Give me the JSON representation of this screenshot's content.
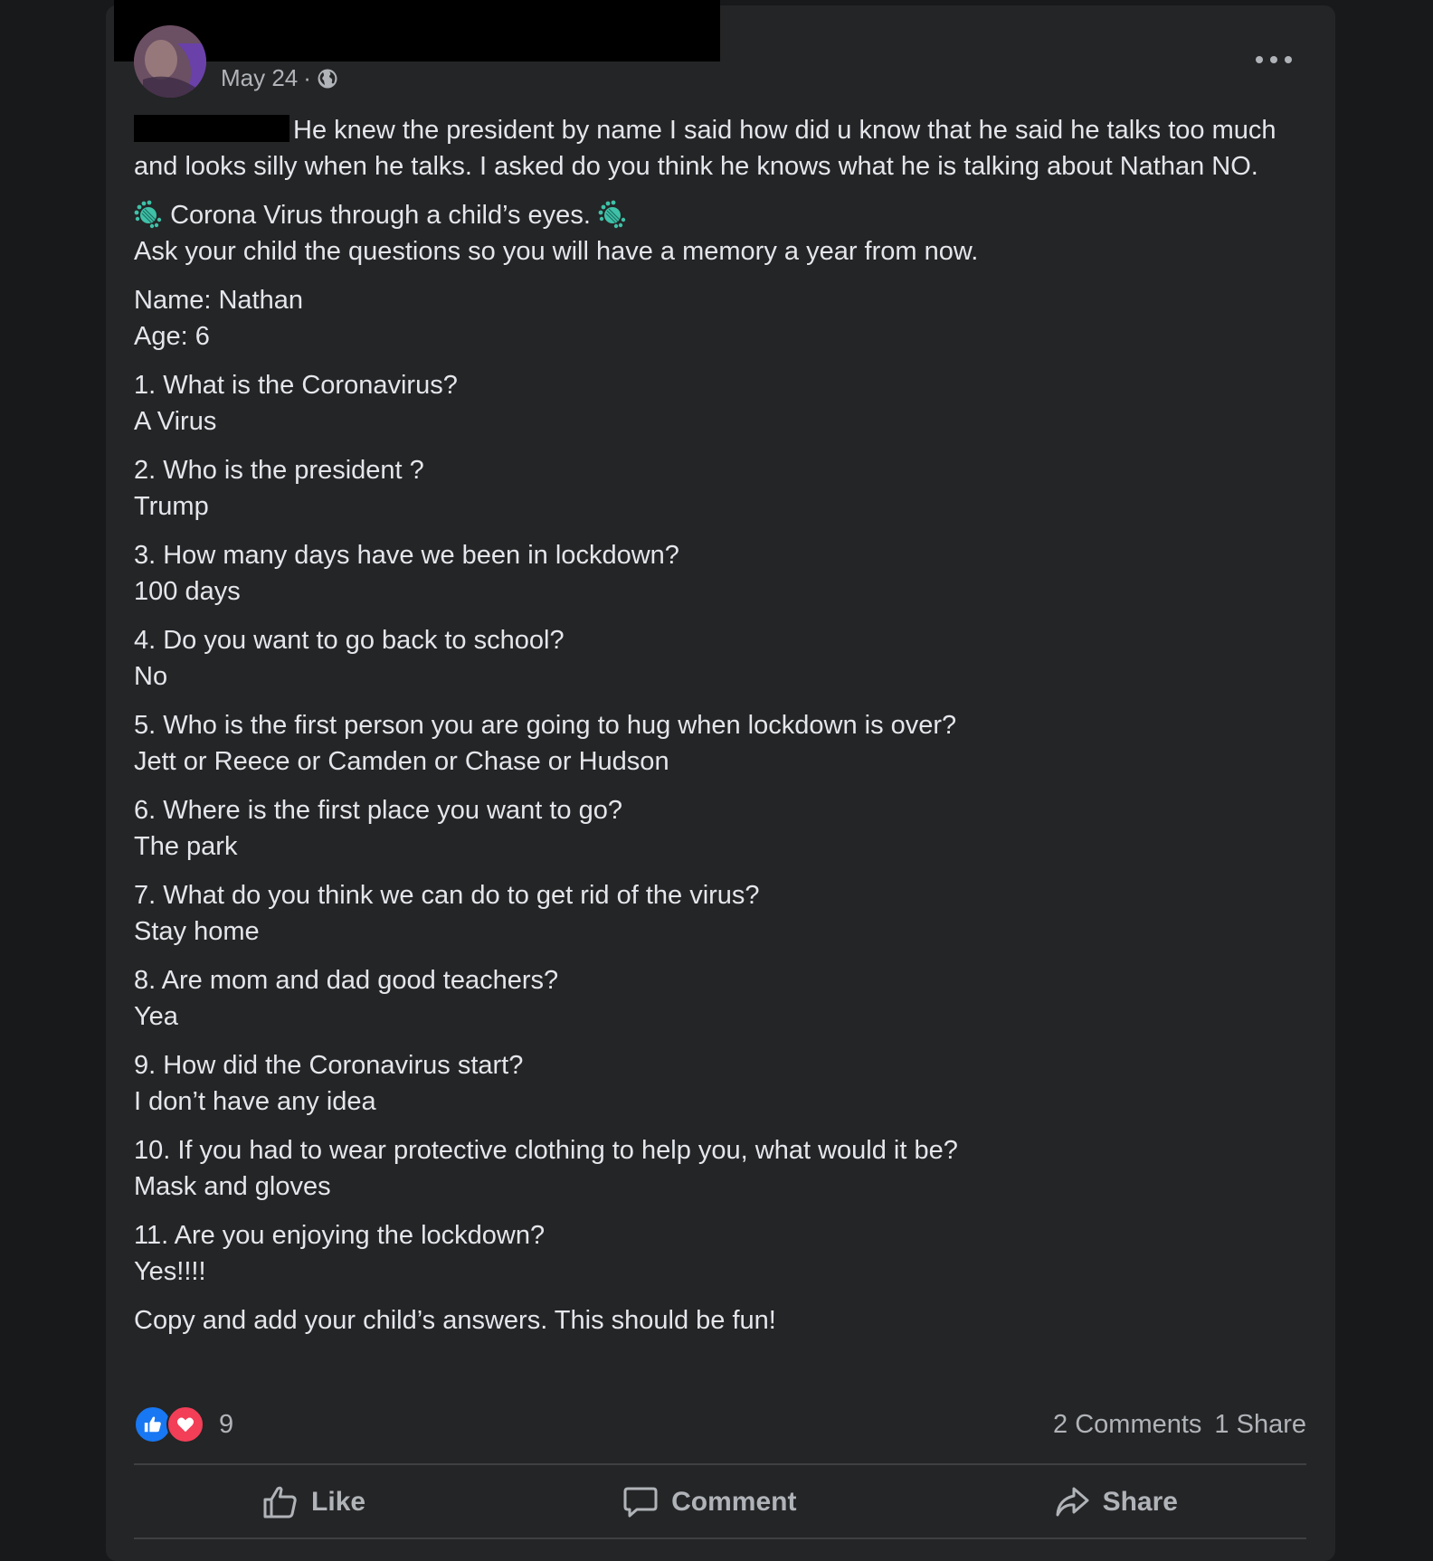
{
  "post": {
    "date": "May 24",
    "separator": "·",
    "paragraphs": {
      "intro": "He knew the president by name I said how did u know that he said he talks too much and looks silly when he talks. I asked do you think he knows what he is talking about Nathan NO.",
      "title": "Corona Virus through a child’s eyes.",
      "subtitle": "Ask your child the questions so you will have a memory a year from now.",
      "name": "Name: Nathan",
      "age": "Age: 6",
      "qa": [
        {
          "q": "1. What is the Coronavirus?",
          "a": "A Virus"
        },
        {
          "q": "2. Who is the president ?",
          "a": "Trump"
        },
        {
          "q": "3. How many days have we been in lockdown?",
          "a": "100 days"
        },
        {
          "q": "4. Do you want to go back to school?",
          "a": "No"
        },
        {
          "q": "5. Who is the first person you are going to hug when lockdown is over?",
          "a": "Jett or Reece or Camden or Chase or Hudson"
        },
        {
          "q": "6. Where is the first place you want to go?",
          "a": "The park"
        },
        {
          "q": "7. What do you think we can do to get rid of the virus?",
          "a": "Stay home"
        },
        {
          "q": "8. Are mom and dad good teachers?",
          "a": "Yea"
        },
        {
          "q": "9. How did the Coronavirus start?",
          "a": "I don’t have any idea"
        },
        {
          "q": "10. If you had to wear protective clothing to help you, what would it be?",
          "a": "Mask and gloves"
        },
        {
          "q": "11. Are you enjoying the lockdown?",
          "a": "Yes!!!!"
        }
      ],
      "outro": "Copy and add your child’s answers.  This should be fun!"
    }
  },
  "stats": {
    "reaction_count": "9",
    "comments": "2 Comments",
    "shares": "1 Share"
  },
  "actions": {
    "like": "Like",
    "comment": "Comment",
    "share": "Share"
  },
  "colors": {
    "background": "#18191a",
    "card": "#242526",
    "text": "#e4e6eb",
    "secondary": "#b0b3b8",
    "like_blue": "#1877f2",
    "love_red": "#f33e58",
    "virus_teal": "#3fc1a8"
  }
}
